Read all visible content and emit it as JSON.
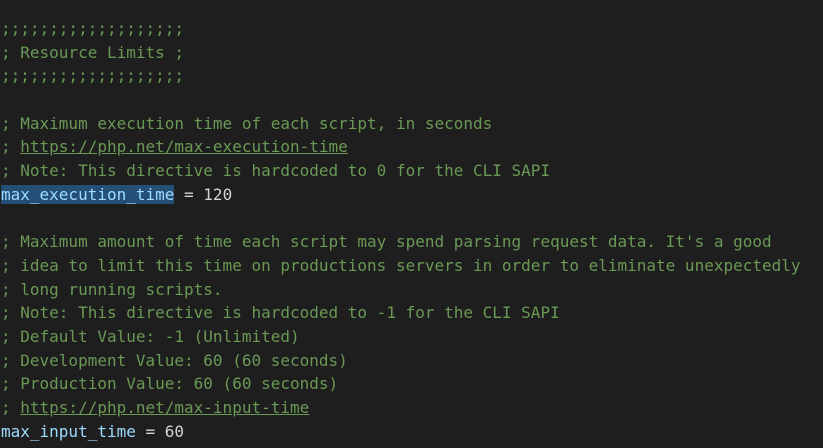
{
  "editor": {
    "lines": {
      "l1": ";;;;;;;;;;;;;;;;;;;",
      "l2": "; Resource Limits ;",
      "l3": ";;;;;;;;;;;;;;;;;;;",
      "l4": "",
      "l5": "; Maximum execution time of each script, in seconds",
      "l6_prefix": "; ",
      "l6_link": "https://php.net/max-execution-time",
      "l7": "; Note: This directive is hardcoded to 0 for the CLI SAPI",
      "l8_key": "max_execution_time",
      "l8_op": " = ",
      "l8_val": "120",
      "l9": "",
      "l10": "; Maximum amount of time each script may spend parsing request data. It's a good",
      "l11": "; idea to limit this time on productions servers in order to eliminate unexpectedly",
      "l12": "; long running scripts.",
      "l13": "; Note: This directive is hardcoded to -1 for the CLI SAPI",
      "l14": "; Default Value: -1 (Unlimited)",
      "l15": "; Development Value: 60 (60 seconds)",
      "l16": "; Production Value: 60 (60 seconds)",
      "l17_prefix": "; ",
      "l17_link": "https://php.net/max-input-time",
      "l18_key": "max_input_time",
      "l18_op": " = ",
      "l18_val": "60"
    }
  },
  "colors": {
    "background": "#1e1e1e",
    "comment": "#6a9955",
    "key": "#9cdcfe",
    "text": "#d4d4d4",
    "selection": "#264f78"
  }
}
